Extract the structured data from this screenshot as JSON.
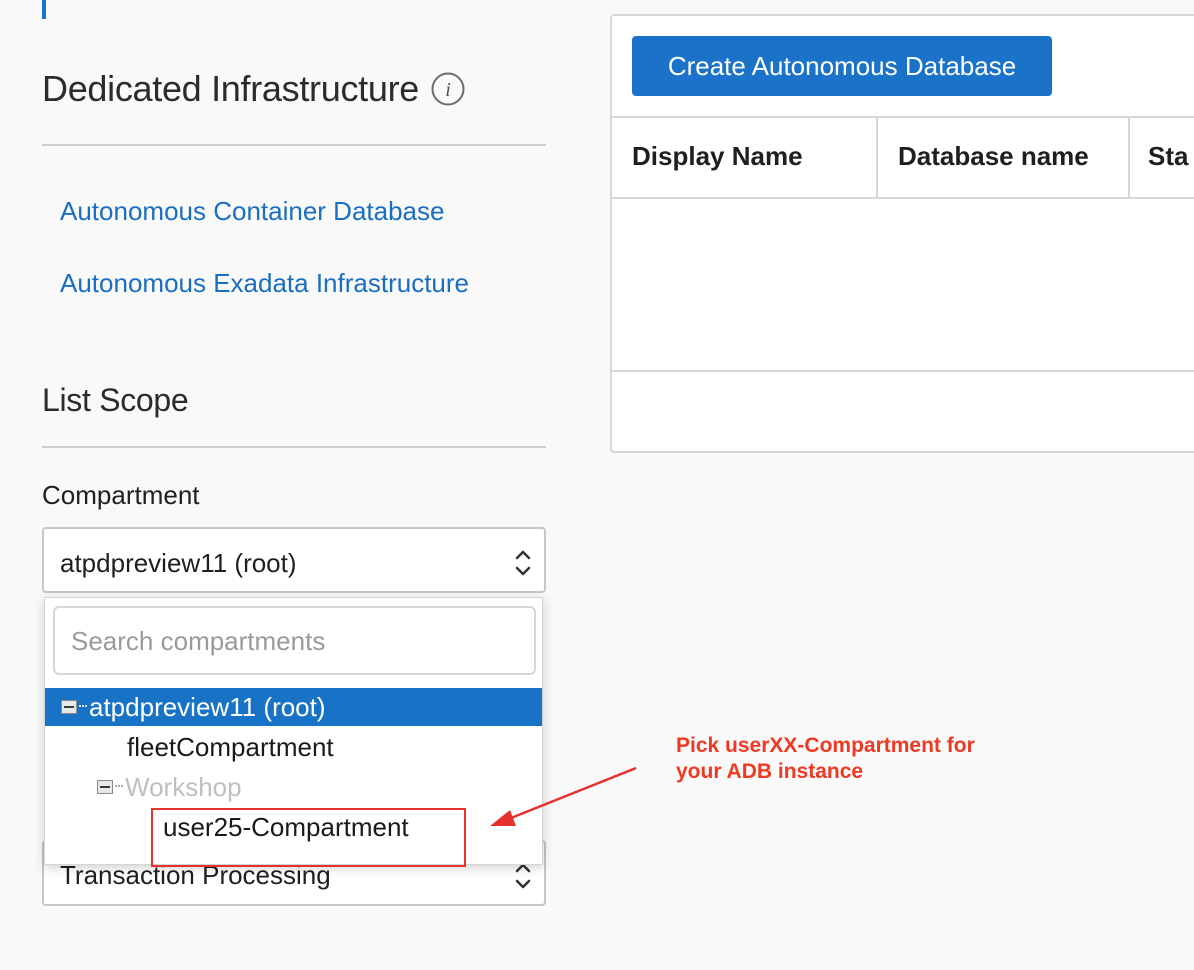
{
  "sidebar": {
    "dedicated_title": "Dedicated Infrastructure",
    "info_icon": "info-icon",
    "links": [
      "Autonomous Container Database",
      "Autonomous Exadata Infrastructure"
    ],
    "list_scope_title": "List Scope",
    "compartment_label": "Compartment",
    "compartment_value": "atpdpreview11 (root)",
    "workload_value": "Transaction Processing"
  },
  "compartment_dropdown": {
    "search_placeholder": "Search compartments",
    "items": [
      {
        "label": "atpdpreview11 (root)",
        "selected": true,
        "expandable": true
      },
      {
        "label": "fleetCompartment",
        "selected": false,
        "expandable": false
      },
      {
        "label": "Workshop",
        "selected": false,
        "expandable": true,
        "muted": true
      },
      {
        "label": "user25-Compartment",
        "selected": false,
        "expandable": false
      }
    ]
  },
  "main": {
    "create_button": "Create Autonomous Database",
    "table_headers": [
      "Display Name",
      "Database name",
      "Sta"
    ]
  },
  "annotation": {
    "line1": "Pick userXX-Compartment for",
    "line2": "your ADB instance",
    "color": "#ee3a22"
  },
  "colors": {
    "accent": "#1a73c9",
    "selected_row": "#1872c5",
    "link": "#1a6ec0",
    "highlight": "#e5322d"
  }
}
